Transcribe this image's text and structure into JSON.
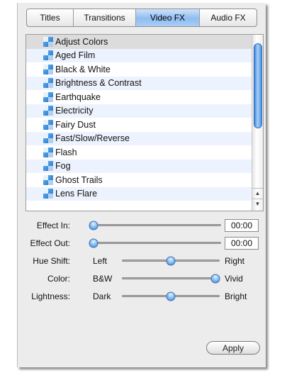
{
  "tabs": [
    {
      "label": "Titles"
    },
    {
      "label": "Transitions"
    },
    {
      "label": "Video FX",
      "active": true
    },
    {
      "label": "Audio FX"
    }
  ],
  "effects_list": {
    "selected": "Adjust Colors",
    "items": [
      "Adjust Colors",
      "Aged Film",
      "Black & White",
      "Brightness & Contrast",
      "Earthquake",
      "Electricity",
      "Fairy Dust",
      "Fast/Slow/Reverse",
      "Flash",
      "Fog",
      "Ghost Trails",
      "Lens Flare"
    ],
    "item_icon": "effect-icon"
  },
  "controls": {
    "effect_in": {
      "label": "Effect In:",
      "time": "00:00",
      "value": 0
    },
    "effect_out": {
      "label": "Effect Out:",
      "time": "00:00",
      "value": 0
    },
    "hue_shift": {
      "label": "Hue Shift:",
      "min_label": "Left",
      "max_label": "Right",
      "value": 0.5
    },
    "color": {
      "label": "Color:",
      "min_label": "B&W",
      "max_label": "Vivid",
      "value": 1.0
    },
    "lightness": {
      "label": "Lightness:",
      "min_label": "Dark",
      "max_label": "Bright",
      "value": 0.5
    }
  },
  "apply_button": {
    "label": "Apply"
  },
  "colors": {
    "accent": "#8fbcf0",
    "panel_background": "#ececec",
    "row_stripe": "#edf3fe",
    "row_selected": "#dcdcdc"
  }
}
